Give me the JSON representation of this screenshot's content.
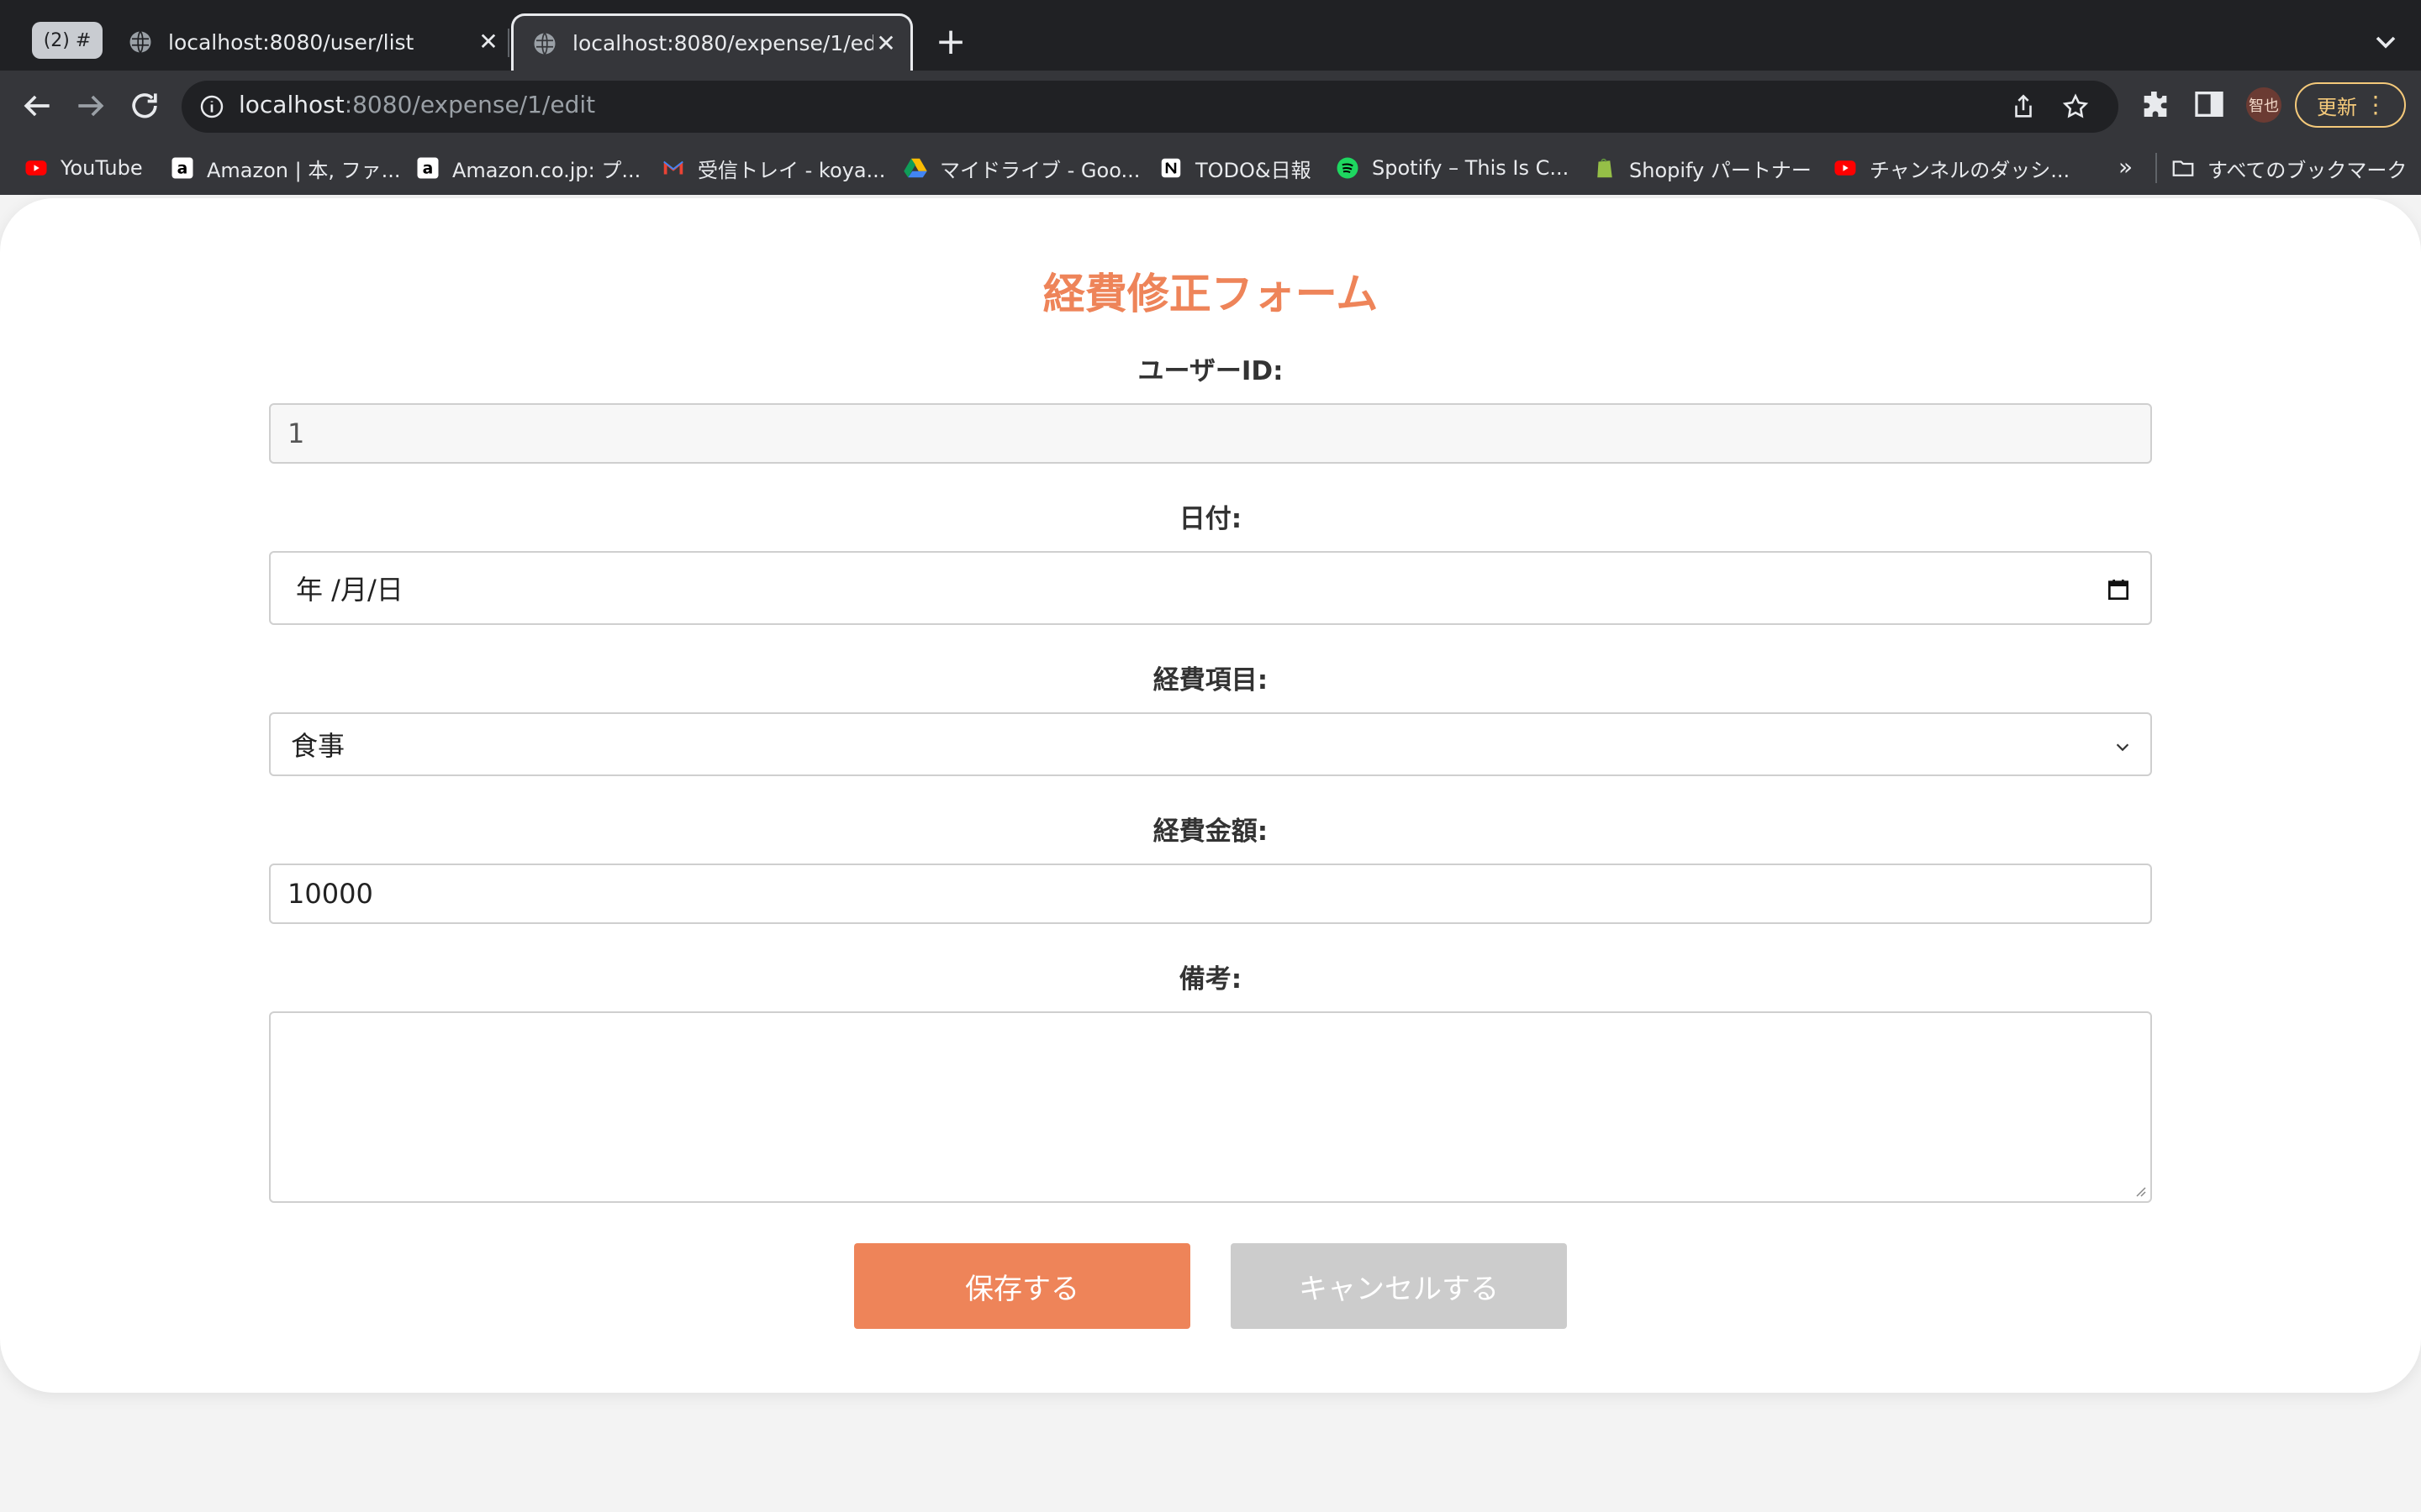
{
  "browser": {
    "tab_group_label": "(2) #",
    "tabs": [
      {
        "title": "localhost:8080/user/list"
      },
      {
        "title": "localhost:8080/expense/1/edit"
      }
    ],
    "url_host": "localhost",
    "url_rest": ":8080/expense/1/edit",
    "profile_label": "智也",
    "update_label": "更新",
    "bookmarks": [
      {
        "label": "YouTube",
        "icon": "youtube-icon"
      },
      {
        "label": "Amazon | 本, ファ...",
        "icon": "amazon-icon"
      },
      {
        "label": "Amazon.co.jp: プ...",
        "icon": "amazon-icon"
      },
      {
        "label": "受信トレイ - koya...",
        "icon": "gmail-icon"
      },
      {
        "label": "マイドライブ - Goo...",
        "icon": "google-drive-icon"
      },
      {
        "label": "TODO&日報",
        "icon": "notion-icon"
      },
      {
        "label": "Spotify – This Is C...",
        "icon": "spotify-icon"
      },
      {
        "label": "Shopify パートナー",
        "icon": "shopify-icon"
      },
      {
        "label": "チャンネルのダッシ...",
        "icon": "youtube-icon"
      }
    ],
    "bookmarks_overflow": "»",
    "all_bookmarks_label": "すべてのブックマーク"
  },
  "form": {
    "title": "経費修正フォーム",
    "user_id": {
      "label": "ユーザーID:",
      "value": "1"
    },
    "date": {
      "label": "日付:",
      "value": "年 /月/日"
    },
    "category": {
      "label": "経費項目:",
      "value": "食事"
    },
    "amount": {
      "label": "経費金額:",
      "value": "10000"
    },
    "note": {
      "label": "備考:",
      "value": ""
    },
    "save_label": "保存する",
    "cancel_label": "キャンセルする"
  },
  "colors": {
    "accent": "#ee8459",
    "cancel": "#cccccc",
    "chrome_dark": "#202124",
    "chrome_toolbar": "#35363a"
  }
}
